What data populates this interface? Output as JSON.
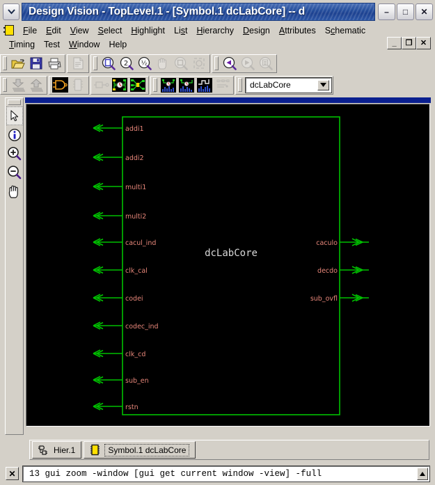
{
  "window": {
    "title": "Design Vision - TopLevel.1 - [Symbol.1   dcLabCore] -- d",
    "sysmenu_icon": "chevron-down-icon",
    "minimize_label": "–",
    "maximize_label": "□",
    "close_label": "✕"
  },
  "menubar": {
    "app_icon": "chip-icon",
    "row1": [
      {
        "label": "File",
        "accel": "F"
      },
      {
        "label": "Edit",
        "accel": "E"
      },
      {
        "label": "View",
        "accel": "V"
      },
      {
        "label": "Select",
        "accel": "S"
      },
      {
        "label": "Highlight",
        "accel": "H"
      },
      {
        "label": "List",
        "accel": "s"
      },
      {
        "label": "Hierarchy",
        "accel": "H"
      },
      {
        "label": "Design",
        "accel": "D"
      },
      {
        "label": "Attributes",
        "accel": "A"
      },
      {
        "label": "Schematic",
        "accel": "c"
      }
    ],
    "row2": [
      {
        "label": "Timing",
        "accel": "T"
      },
      {
        "label": "Test",
        "accel": ""
      },
      {
        "label": "Window",
        "accel": "W"
      },
      {
        "label": "Help",
        "accel": ""
      }
    ],
    "mdi_buttons": [
      {
        "name": "mdi-minimize",
        "label": "_"
      },
      {
        "name": "mdi-restore",
        "label": "❐"
      },
      {
        "name": "mdi-close",
        "label": "✕"
      }
    ]
  },
  "toolbar1": {
    "groups": [
      {
        "name": "file-group",
        "buttons": [
          {
            "name": "open-icon",
            "title": "Open Design",
            "enabled": true
          },
          {
            "name": "save-icon",
            "title": "Save Design",
            "enabled": true
          },
          {
            "name": "print-icon",
            "title": "Print",
            "enabled": true
          }
        ]
      },
      {
        "name": "report-group",
        "buttons": [
          {
            "name": "report-icon",
            "title": "Report",
            "enabled": false
          }
        ]
      },
      {
        "name": "zoom-group",
        "buttons": [
          {
            "name": "zoom-fit-icon",
            "title": "Zoom Fit",
            "enabled": true
          },
          {
            "name": "zoom-2x-icon",
            "title": "Zoom In 2x",
            "label": "2",
            "enabled": true
          },
          {
            "name": "zoom-half-icon",
            "title": "Zoom Out 1/2",
            "label": "½",
            "enabled": true
          },
          {
            "name": "pan-icon",
            "title": "Pan",
            "enabled": false
          },
          {
            "name": "zoom-window-icon",
            "title": "Zoom Window",
            "enabled": false
          },
          {
            "name": "zoom-selection-icon",
            "title": "Zoom Selection",
            "enabled": false
          }
        ]
      },
      {
        "name": "navigate-group",
        "buttons": [
          {
            "name": "back-icon",
            "title": "Back",
            "enabled": true
          },
          {
            "name": "forward-icon",
            "title": "Forward",
            "enabled": false
          },
          {
            "name": "list-view-icon",
            "title": "List View",
            "enabled": false
          }
        ]
      }
    ]
  },
  "toolbar2": {
    "groups": [
      {
        "name": "hierarchy-group",
        "buttons": [
          {
            "name": "push-down-icon",
            "title": "Push Down",
            "enabled": false
          },
          {
            "name": "pop-up-icon",
            "title": "Pop Up",
            "enabled": false
          }
        ]
      },
      {
        "name": "view-group",
        "buttons": [
          {
            "name": "schematic-gate-icon",
            "title": "Schematic View",
            "enabled": true
          },
          {
            "name": "symbol-icon",
            "title": "Symbol View",
            "enabled": false
          }
        ]
      },
      {
        "name": "path-group",
        "buttons": [
          {
            "name": "path-icon",
            "title": "Path",
            "enabled": false
          },
          {
            "name": "path-timing-icon",
            "title": "Path Timing",
            "enabled": true
          },
          {
            "name": "path-schematic-icon",
            "title": "Path Schematic",
            "enabled": true
          }
        ]
      },
      {
        "name": "analysis-group",
        "buttons": [
          {
            "name": "histogram-path-icon",
            "title": "Path Histogram",
            "enabled": true
          },
          {
            "name": "endpoint-slack-icon",
            "title": "Endpoint Slack",
            "enabled": true
          },
          {
            "name": "histogram-icon",
            "title": "Histogram",
            "enabled": true
          },
          {
            "name": "net-list-icon",
            "title": "Net List",
            "enabled": false
          }
        ]
      }
    ],
    "design_combo": {
      "name": "design-selector",
      "value": "dcLabCore",
      "arrow_icon": "chevron-down-icon"
    }
  },
  "vtools": {
    "buttons": [
      {
        "name": "select-arrow-icon",
        "title": "Select",
        "active": true
      },
      {
        "name": "info-icon",
        "title": "Object Info",
        "active": false
      },
      {
        "name": "zoom-in-icon",
        "title": "Zoom In",
        "active": false
      },
      {
        "name": "zoom-out-icon",
        "title": "Zoom Out",
        "active": false
      },
      {
        "name": "hand-pan-icon",
        "title": "Pan",
        "active": false
      }
    ]
  },
  "schematic": {
    "block_name": "dcLabCore",
    "background": "#000000",
    "wire_color": "#00c000",
    "label_color": "#e8877a",
    "block_label_color": "#d8d8d8",
    "inputs": [
      "addi1",
      "addi2",
      "multi1",
      "multi2",
      "cacul_ind",
      "clk_cal",
      "codei",
      "codec_ind",
      "clk_cd",
      "sub_en",
      "rstn"
    ],
    "outputs": [
      "caculo",
      "decdo",
      "sub_ovfl"
    ]
  },
  "tabs": [
    {
      "name": "tab-hier",
      "label": "Hier.1",
      "icon": "hierarchy-icon",
      "selected": false
    },
    {
      "name": "tab-symbol",
      "label": "Symbol.1   dcLabCore",
      "icon": "chip-icon",
      "selected": true
    }
  ],
  "command_line": {
    "close_label": "✕",
    "text": "13   gui zoom -window [gui get current window -view] -full",
    "scroll_icon": "scroll-up-icon"
  }
}
